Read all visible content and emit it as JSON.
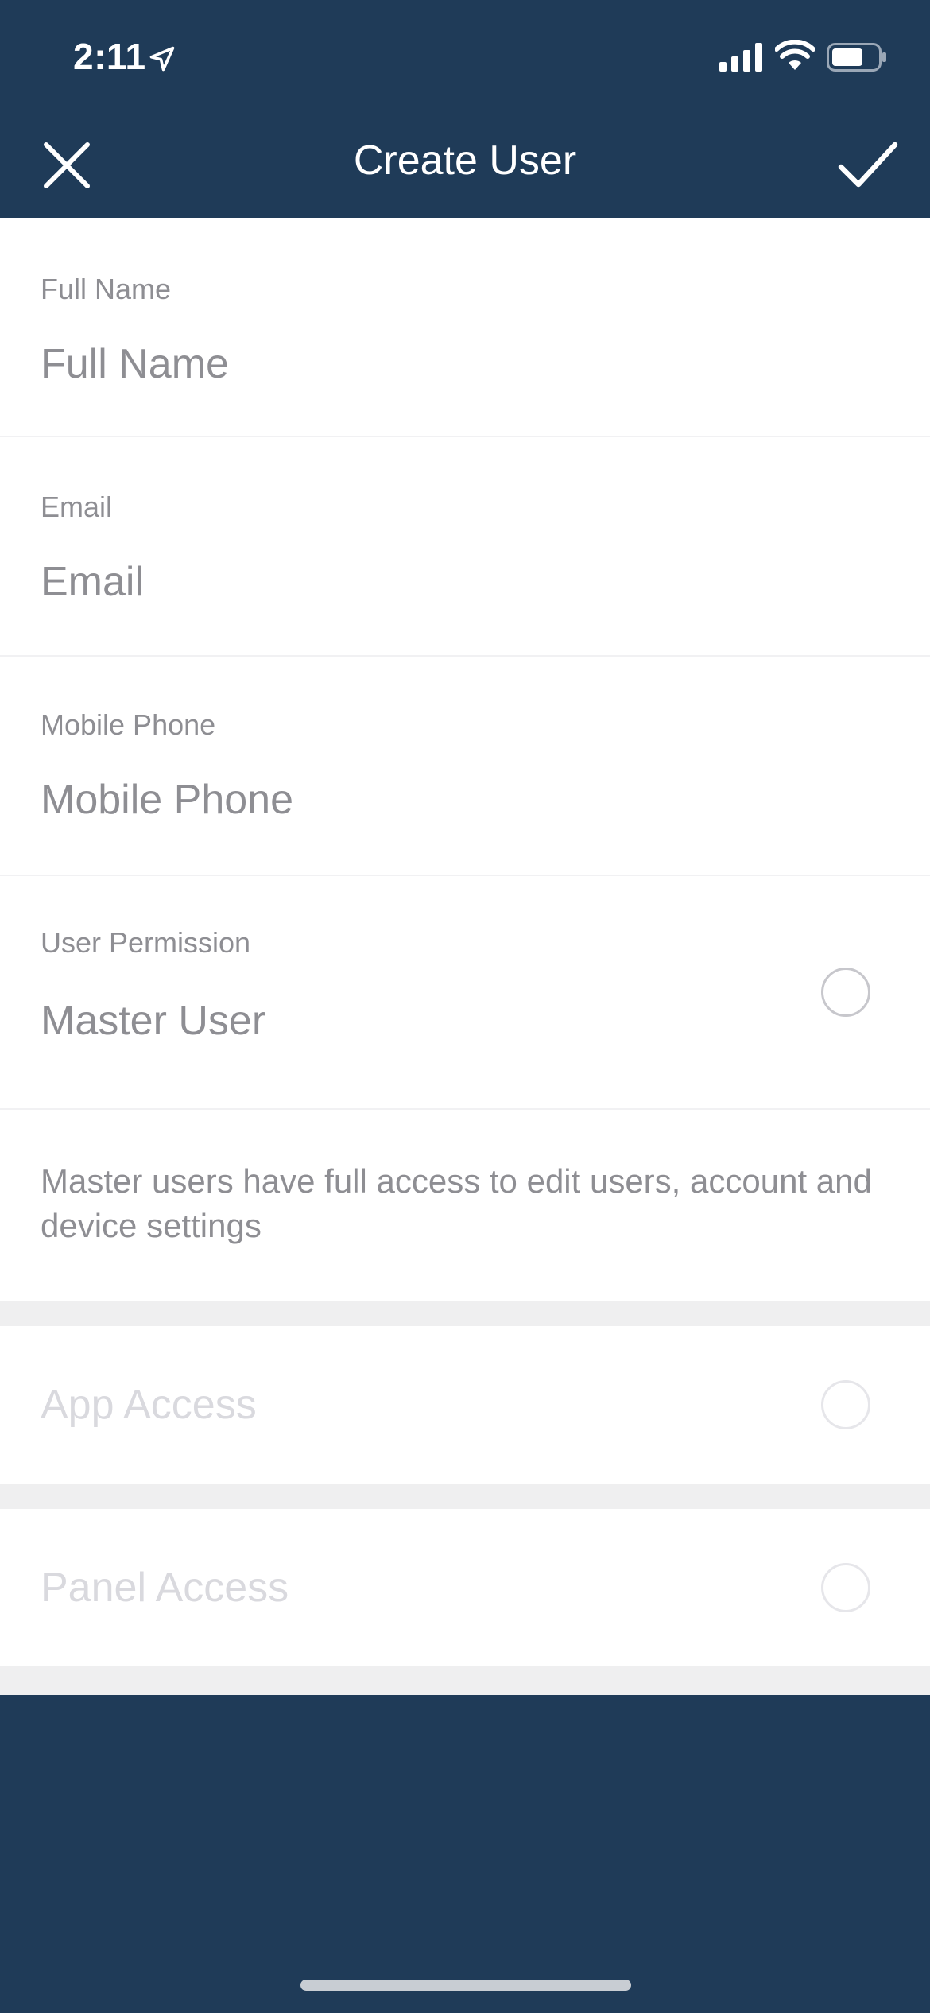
{
  "status_bar": {
    "time": "2:11",
    "icons": [
      "location-arrow-icon",
      "cellular-signal-icon",
      "wifi-icon",
      "battery-icon"
    ]
  },
  "nav": {
    "title": "Create User",
    "close_icon": "close-icon",
    "confirm_icon": "checkmark-icon"
  },
  "form": {
    "full_name": {
      "label": "Full Name",
      "placeholder": "Full Name",
      "value": ""
    },
    "email": {
      "label": "Email",
      "placeholder": "Email",
      "value": ""
    },
    "mobile_phone": {
      "label": "Mobile Phone",
      "placeholder": "Mobile Phone",
      "value": ""
    },
    "user_permission": {
      "label": "User Permission",
      "value": "Master User",
      "selected": false
    },
    "master_user_description": "Master users have full access to edit users, account and device settings",
    "app_access": {
      "label": "App Access",
      "selected": false,
      "enabled": false
    },
    "panel_access": {
      "label": "Panel Access",
      "selected": false,
      "enabled": false
    }
  },
  "colors": {
    "header_background": "#1f3b58",
    "form_background": "#ffffff",
    "section_gap": "#efeff0",
    "label_text": "#8e8e93",
    "disabled_text": "#d9d9de"
  }
}
